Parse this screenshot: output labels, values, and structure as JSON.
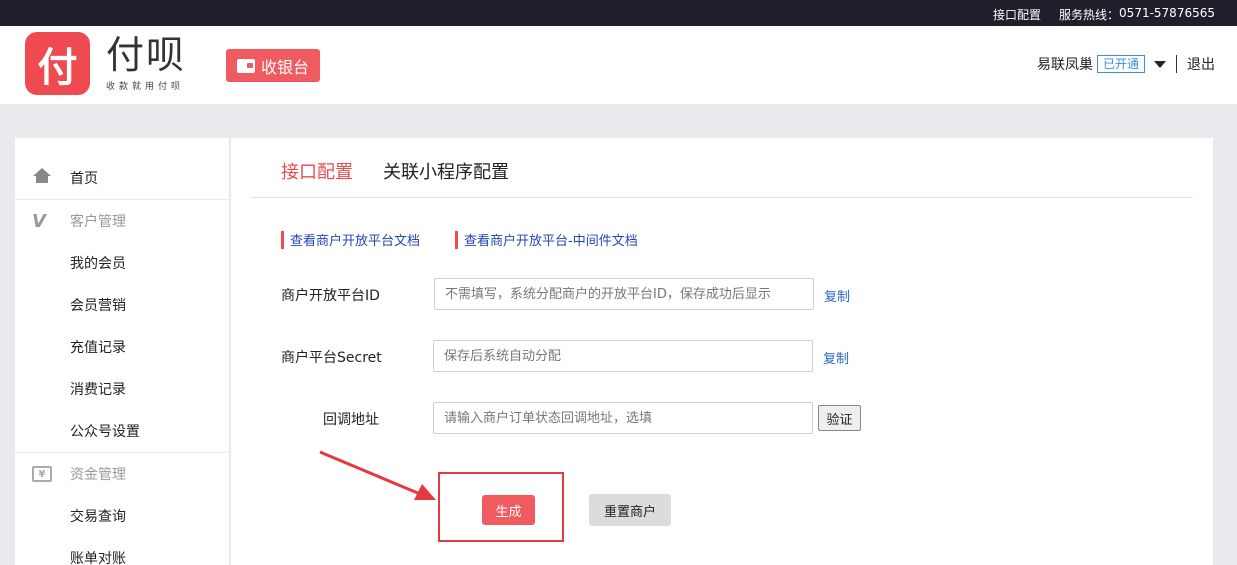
{
  "topbar": {
    "link_config": "接口配置",
    "hotline_label": "服务热线：",
    "hotline_number": "0571-57876565"
  },
  "header": {
    "logo_glyph": "付",
    "brand_name": "付呗",
    "brand_slogan": "收款就用付呗",
    "cashier_label": "收银台",
    "user_name": "易联凤巢",
    "status_badge": "已开通",
    "logout": "退出"
  },
  "sidebar": {
    "home": "首页",
    "group_customer": "客户管理",
    "my_members": "我的会员",
    "member_marketing": "会员营销",
    "recharge_records": "充值记录",
    "consume_records": "消费记录",
    "official_account": "公众号设置",
    "group_funds": "资金管理",
    "trade_query": "交易查询",
    "bill_reconcile": "账单对账"
  },
  "main": {
    "tab_active": "接口配置",
    "tab_other": "关联小程序配置",
    "doc_link_1": "查看商户开放平台文档",
    "doc_link_2": "查看商户开放平台-中间件文档",
    "form": {
      "platform_id_label": "商户开放平台ID",
      "platform_id_placeholder": "不需填写，系统分配商户的开放平台ID，保存成功后显示",
      "secret_label": "商户平台Secret",
      "secret_placeholder": "保存后系统自动分配",
      "callback_label": "回调地址",
      "callback_placeholder": "请输入商户订单状态回调地址，选填",
      "copy_label": "复制",
      "verify_label": "验证"
    },
    "generate_label": "生成",
    "reset_label": "重置商户"
  },
  "colors": {
    "brand_red": "#ef4a50",
    "topbar_bg": "#1f1f2c",
    "link_blue": "#2346b8",
    "highlight": "#e5393f"
  }
}
